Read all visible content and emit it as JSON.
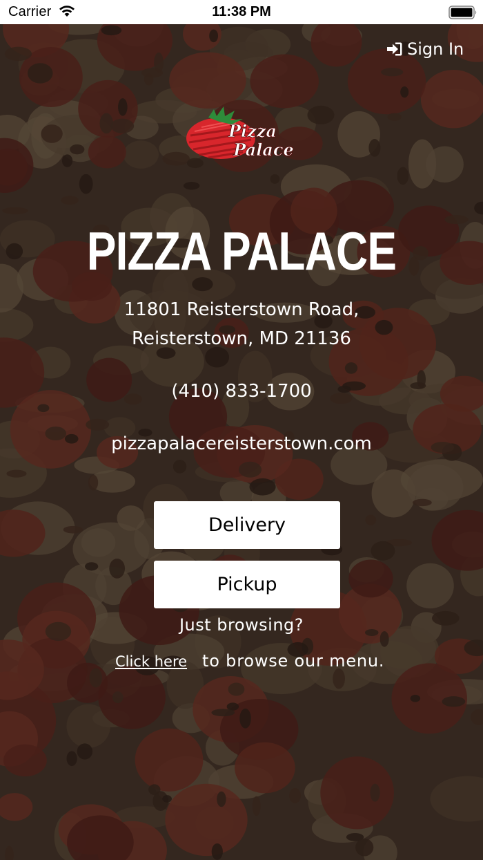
{
  "status_bar": {
    "carrier": "Carrier",
    "time": "11:38 PM",
    "icons": [
      "wifi-icon",
      "battery-icon"
    ]
  },
  "header": {
    "sign_in_label": "Sign In",
    "sign_in_icon": "sign-in-icon"
  },
  "logo": {
    "text_line_1": "Pizza",
    "text_line_2": "Palace"
  },
  "restaurant": {
    "name": "PIZZA PALACE",
    "address_line_1": "11801 Reisterstown Road,",
    "address_line_2": "Reisterstown, MD 21136",
    "phone": "(410) 833-1700",
    "website": "pizzapalacereisterstown.com"
  },
  "order_options": {
    "delivery_label": "Delivery",
    "pickup_label": "Pickup"
  },
  "browse": {
    "question": "Just browsing?",
    "link_label": "Click here",
    "suffix": "to browse our menu."
  },
  "colors": {
    "overlay_text": "#ffffff",
    "button_background": "#ffffff",
    "button_text": "#000000",
    "logo_red": "#d8262c",
    "logo_green": "#2e8b3a"
  }
}
